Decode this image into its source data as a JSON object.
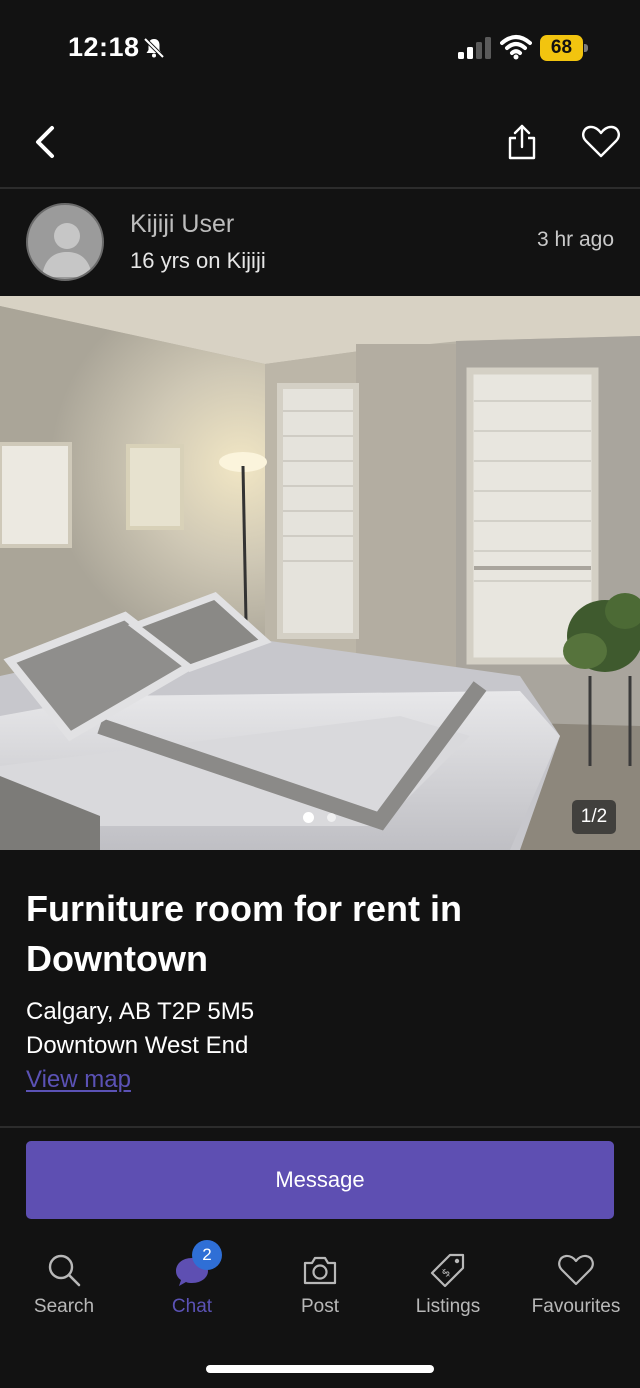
{
  "status_bar": {
    "time": "12:18",
    "battery": "68",
    "icons": [
      "bell-slash-icon",
      "signal-icon",
      "wifi-icon",
      "battery-icon"
    ]
  },
  "top_nav": {
    "icons": [
      "back-icon",
      "share-icon",
      "heart-icon"
    ]
  },
  "seller": {
    "name": "Kijiji User",
    "membership": "16 yrs on Kijiji",
    "posted": "3 hr  ago"
  },
  "photo": {
    "counter": "1/2",
    "current_index": 1,
    "total": 2
  },
  "listing": {
    "title": "Furniture room for rent in Downtown",
    "address": "Calgary, AB T2P 5M5",
    "neighborhood": "Downtown West End",
    "view_map": "View map"
  },
  "actions": {
    "message": "Message"
  },
  "tabbar": {
    "items": [
      {
        "label": "Search",
        "icon": "search-icon"
      },
      {
        "label": "Chat",
        "icon": "chat-icon",
        "badge": "2",
        "active": true
      },
      {
        "label": "Post",
        "icon": "camera-icon"
      },
      {
        "label": "Listings",
        "icon": "tag-icon"
      },
      {
        "label": "Favourites",
        "icon": "heart-icon"
      }
    ]
  },
  "colors": {
    "background": "#121212",
    "accent": "#5e4fb2",
    "link": "#5b52b5",
    "badge": "#2f6fd6",
    "battery": "#f2c40f"
  }
}
